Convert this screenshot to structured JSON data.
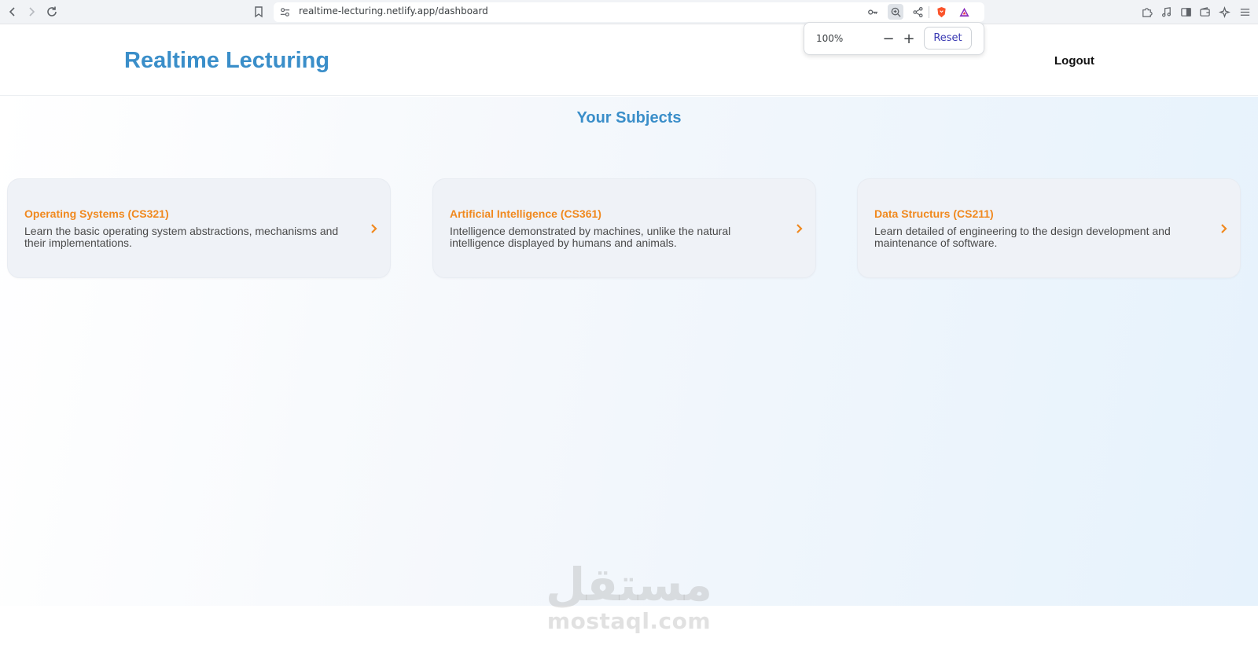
{
  "browser": {
    "url": "realtime-lecturing.netlify.app/dashboard",
    "icons": [
      "back-icon",
      "forward-icon",
      "reload-icon",
      "bookmark-icon",
      "site-settings-icon",
      "key-icon",
      "zoom-icon",
      "share-icon",
      "brave-shield-icon",
      "rewards-icon",
      "extensions-icon",
      "media-icon",
      "sidebar-icon",
      "wallet-icon",
      "leo-icon",
      "menu-icon"
    ]
  },
  "zoom_popup": {
    "level": "100%",
    "minus": "−",
    "plus": "+",
    "reset_label": "Reset"
  },
  "header": {
    "title": "Realtime Lecturing",
    "logout_label": "Logout"
  },
  "main": {
    "section_title": "Your Subjects",
    "subjects": [
      {
        "title": "Operating Systems (CS321)",
        "description": "Learn the basic operating system abstractions, mechanisms and their implementations."
      },
      {
        "title": "Artificial Intelligence (CS361)",
        "description": "Intelligence demonstrated by machines, unlike the natural intelligence displayed by humans and animals."
      },
      {
        "title": "Data Structurs (CS211)",
        "description": "Learn detailed of engineering to the design development and maintenance of software."
      }
    ]
  },
  "watermark": {
    "arabic": "مستقل",
    "latin": "mostaql.com"
  },
  "colors": {
    "brand_blue": "#3a8ec9",
    "accent_orange": "#f0891f",
    "zoom_reset_text": "#3b3bb3"
  }
}
